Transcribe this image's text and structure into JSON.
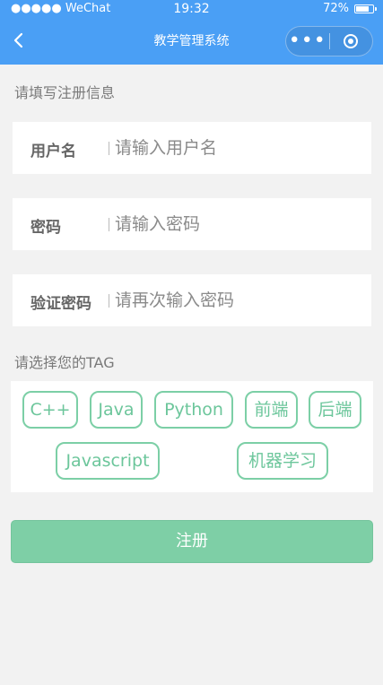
{
  "status_bar": {
    "signal": "●●●●● WeChat",
    "time": "19:32",
    "battery_percent": "72%"
  },
  "nav": {
    "title": "教学管理系统",
    "more_glyph": "•••"
  },
  "form": {
    "section_title": "请填写注册信息",
    "fields": [
      {
        "label": "用户名",
        "placeholder": "请输入用户名",
        "value": ""
      },
      {
        "label": "密码",
        "placeholder": "请输入密码",
        "value": ""
      },
      {
        "label": "验证密码",
        "placeholder": "请再次输入密码",
        "value": ""
      }
    ]
  },
  "tags": {
    "section_title": "请选择您的TAG",
    "items": [
      "C++",
      "Java",
      "Python",
      "前端",
      "后端",
      "Javascript",
      "机器学习"
    ]
  },
  "register_button": {
    "label": "注册"
  },
  "colors": {
    "nav_background": "#4a9ff5",
    "accent_green": "#7ecfa6",
    "page_background": "#f2f2f2"
  }
}
